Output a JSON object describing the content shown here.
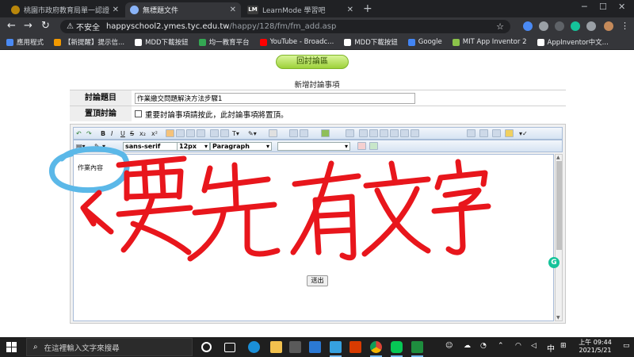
{
  "browser": {
    "tabs": [
      {
        "title": "桃園市政府教育局單一認證授權...",
        "close": "✕"
      },
      {
        "title": "無標題文件",
        "close": "✕"
      },
      {
        "title": "LearnMode 學習吧",
        "close": "✕",
        "favicon_text": "LM"
      }
    ],
    "new_tab": "+",
    "window_controls": {
      "minimize": "─",
      "maximize": "☐",
      "close": "✕"
    },
    "nav": {
      "back": "←",
      "forward": "→",
      "reload": "↻"
    },
    "address": {
      "warning_icon": "⚠",
      "insecure_label": "不安全",
      "host": "happyschool2.ymes.tyc.edu.tw",
      "path": "/happy/128/fm/fm_add.asp",
      "star": "☆"
    },
    "bookmarks": [
      {
        "label": "應用程式",
        "color": "#4a8af4"
      },
      {
        "label": "【新提醒】提示信...",
        "color": "#f29900"
      },
      {
        "label": "MDD下載按鈕",
        "color": "#ffffff"
      },
      {
        "label": "均一教育平台",
        "color": "#34a853"
      },
      {
        "label": "YouTube - Broadc...",
        "color": "#ff0000"
      },
      {
        "label": "MDD下載按鈕",
        "color": "#ffffff"
      },
      {
        "label": "Google",
        "color": "#4285f4"
      },
      {
        "label": "MIT App Inventor 2",
        "color": "#8bc34a"
      },
      {
        "label": "AppInventor中文...",
        "color": "#ffffff"
      }
    ]
  },
  "page": {
    "back_button": "回討論區",
    "form_title": "新增討論事項",
    "subject_label": "討論題目",
    "subject_value": "作業繳交問題解決方法步驟1",
    "pin_label": "置頂討論",
    "pin_text": "重要討論事項請按此，此討論事項將置頂。",
    "editor": {
      "font_family": "sans-serif",
      "font_size": "12px",
      "format": "Paragraph",
      "toolbar_bold": "B",
      "toolbar_italic": "I",
      "toolbar_underline": "U",
      "toolbar_strike": "S",
      "toolbar_sub": "x₂",
      "toolbar_sup": "x²",
      "content": "作業內容"
    },
    "submit_button": "送出",
    "annotation_text": "要先有文字"
  },
  "taskbar": {
    "search_placeholder": "在這裡輸入文字來搜尋",
    "tray_lang": "中",
    "clock_time": "上午 09:44",
    "clock_date": "2021/5/21"
  }
}
